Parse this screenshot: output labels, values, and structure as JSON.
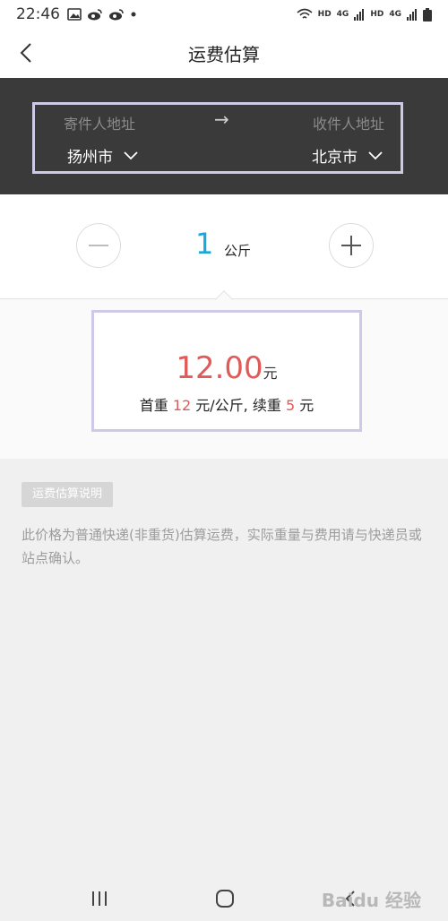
{
  "status_bar": {
    "time": "22:46",
    "network_labels": [
      "HD",
      "4G",
      "HD",
      "4G"
    ]
  },
  "nav": {
    "title": "运费估算"
  },
  "address": {
    "sender_label": "寄件人地址",
    "receiver_label": "收件人地址",
    "arrow": "→",
    "sender_city": "扬州市",
    "receiver_city": "北京市"
  },
  "weight": {
    "value": "1",
    "unit": "公斤"
  },
  "price": {
    "amount": "12.00",
    "currency": "元",
    "detail_prefix": "首重 ",
    "first_weight_price": "12",
    "detail_mid": " 元/公斤, 续重 ",
    "extra_weight_price": "5",
    "detail_suffix": " 元"
  },
  "info": {
    "tag": "运费估算说明",
    "text": "此价格为普通快递(非重货)估算运费，实际重量与费用请与快递员或站点确认。"
  },
  "watermark": "Baidu 经验",
  "colors": {
    "accent_blue": "#1ba8d8",
    "price_red": "#e05a5a",
    "highlight_border": "#cfc8e6",
    "dark_band": "#3a3a3a"
  }
}
